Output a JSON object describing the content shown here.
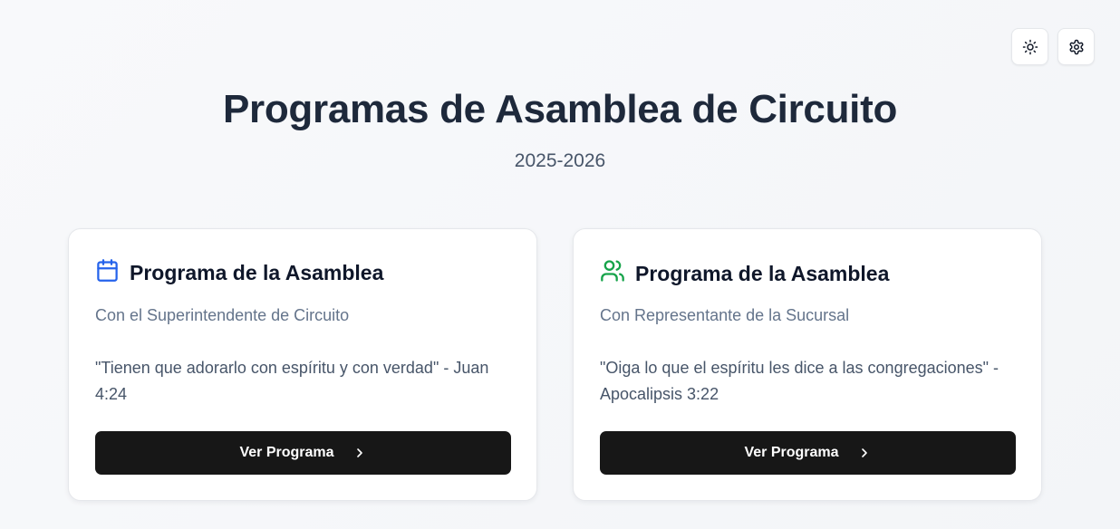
{
  "header": {
    "title": "Programas de Asamblea de Circuito",
    "subtitle": "2025-2026",
    "actions": [
      {
        "icon": "sun-icon",
        "label": "theme-toggle"
      },
      {
        "icon": "gear-icon",
        "label": "settings"
      }
    ]
  },
  "cards": [
    {
      "icon": "calendar-icon",
      "icon_color": "#2563eb",
      "title": "Programa de la Asamblea",
      "description": "Con el Superintendente de Circuito",
      "quote": "\"Tienen que adorarlo con espíritu y con verdad\" - Juan 4:24",
      "button_label": "Ver Programa"
    },
    {
      "icon": "users-icon",
      "icon_color": "#16a34a",
      "title": "Programa de la Asamblea",
      "description": "Con Representante de la Sucursal",
      "quote": "\"Oiga lo que el espíritu les dice a las congregaciones\" - Apocalipsis 3:22",
      "button_label": "Ver Programa"
    }
  ],
  "colors": {
    "background": "#f5f7fa",
    "title": "#1e293b",
    "button": "#171717",
    "button_text": "#ffffff"
  }
}
